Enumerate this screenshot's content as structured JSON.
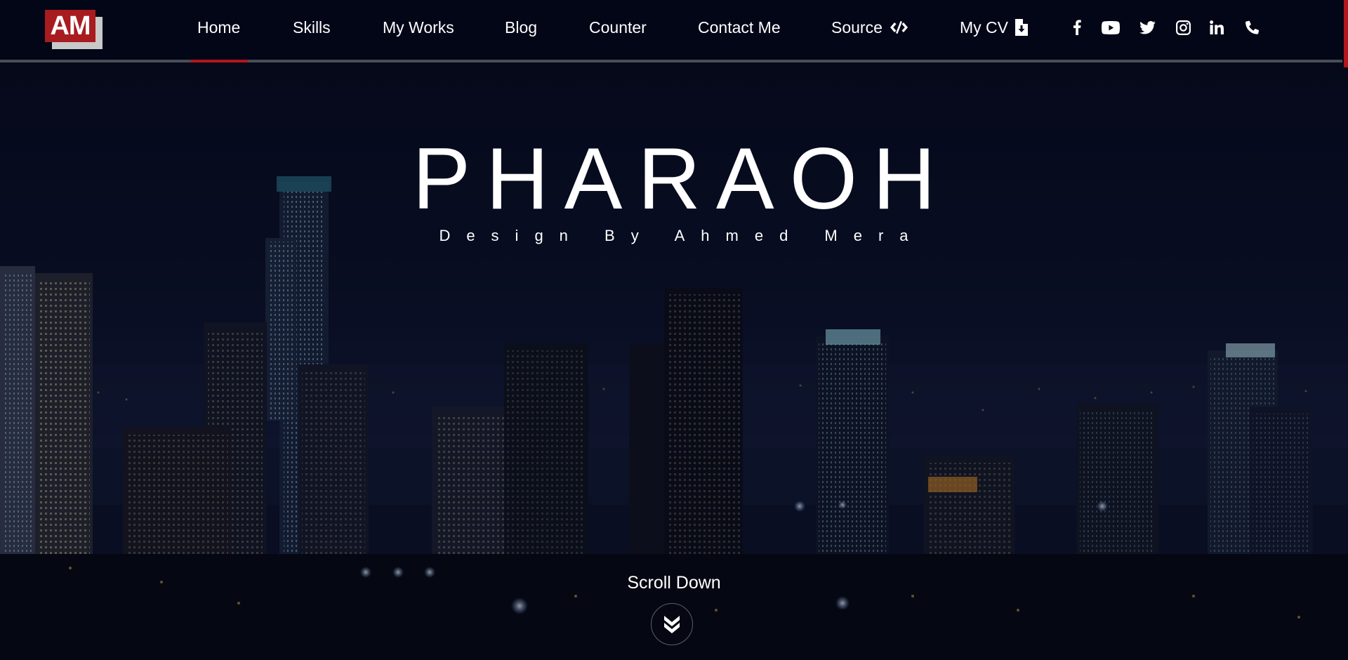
{
  "logo": {
    "text": "AM"
  },
  "nav": {
    "items": [
      {
        "label": "Home",
        "active": true
      },
      {
        "label": "Skills"
      },
      {
        "label": "My Works"
      },
      {
        "label": "Blog"
      },
      {
        "label": "Counter"
      },
      {
        "label": "Contact Me"
      },
      {
        "label": "Source",
        "icon": "code-icon"
      },
      {
        "label": "My CV",
        "icon": "file-download-icon"
      }
    ],
    "social": [
      "facebook-icon",
      "youtube-icon",
      "twitter-icon",
      "instagram-icon",
      "linkedin-icon",
      "phone-icon"
    ]
  },
  "hero": {
    "title": "PHARAOH",
    "subtitle": "Design By Ahmed Mera",
    "scroll_label": "Scroll Down"
  },
  "colors": {
    "accent": "#b3161c",
    "nav_bg": "#020617",
    "logo_bg": "#a81b1f"
  }
}
